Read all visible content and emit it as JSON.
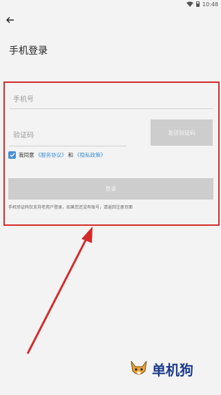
{
  "statusbar": {
    "time": "10:48"
  },
  "header": {
    "title": "手机登录"
  },
  "form": {
    "phone_placeholder": "手机号",
    "code_placeholder": "验证码",
    "send_code_label": "发送验证码",
    "agree_prefix": "我同意",
    "service_link": "《服务协议》",
    "and": "和",
    "privacy_link": "《隐私政策》",
    "login_label": "登录",
    "hint": "手机验证码仅支持老用户登录，如果您还没有账号，请返回注册页面"
  },
  "watermark": {
    "text": "单机狗"
  },
  "colors": {
    "annotation_red": "#d42a2a",
    "link_blue": "#3f8fd6",
    "checkbox_blue": "#4a90d6",
    "disabled_gray": "#cdcdcd"
  }
}
